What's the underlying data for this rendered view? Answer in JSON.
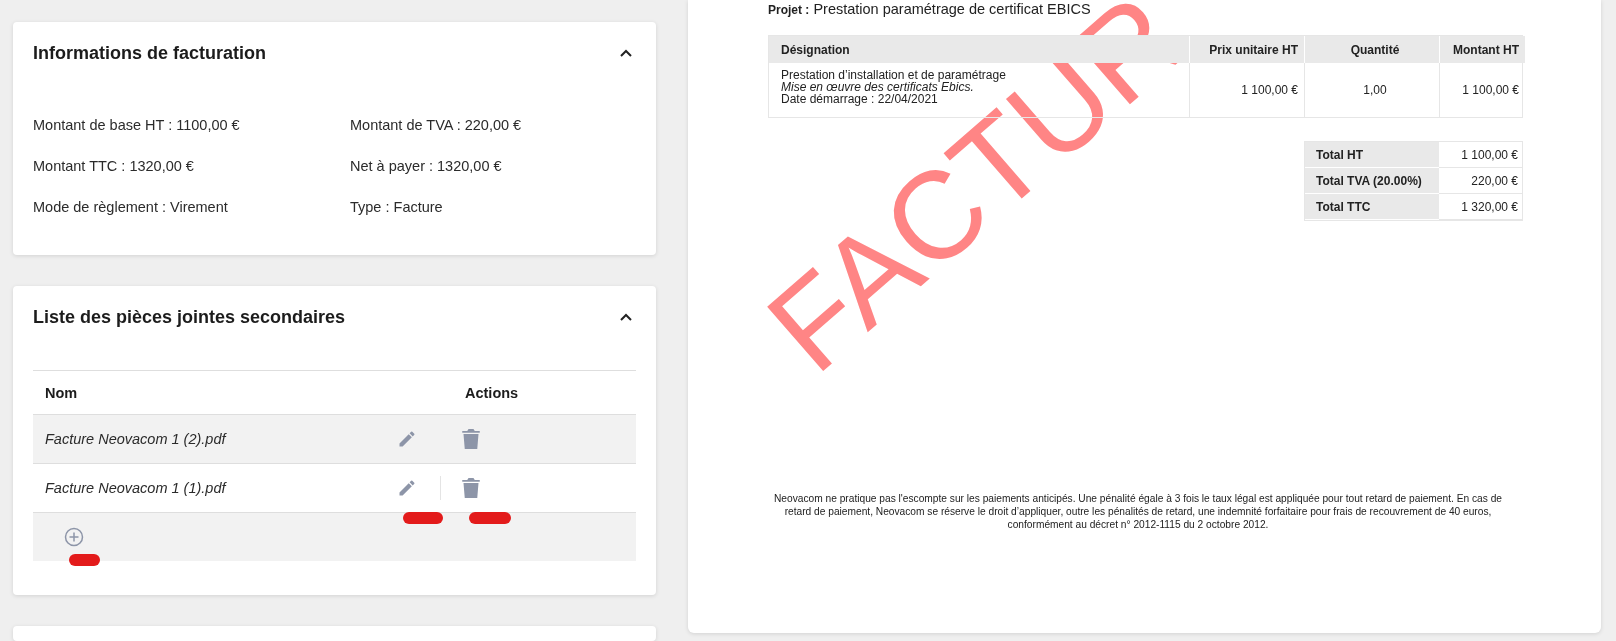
{
  "billing_card": {
    "title": "Informations de facturation",
    "expanded": true,
    "fields": [
      {
        "text": "Montant de base HT : 1100,00 €"
      },
      {
        "text": "Montant de TVA : 220,00 €"
      },
      {
        "text": "Montant TTC : 1320,00 €"
      },
      {
        "text": "Net à payer : 1320,00 €"
      },
      {
        "text": "Mode de règlement : Virement"
      },
      {
        "text": "Type : Facture"
      }
    ]
  },
  "attachments_card": {
    "title": "Liste des pièces jointes secondaires",
    "expanded": true,
    "columns": [
      "Nom",
      "Actions"
    ],
    "rows": [
      {
        "name": "Facture Neovacom 1 (2).pdf"
      },
      {
        "name": "Facture Neovacom 1 (1).pdf"
      }
    ]
  },
  "invoice": {
    "project_label": "Projet :",
    "project": "Prestation paramétrage de certificat EBICS",
    "watermark": "FACTUR",
    "columns": [
      "Désignation",
      "Prix unitaire HT",
      "Quantité",
      "Montant HT"
    ],
    "rows": [
      {
        "designation": "Prestation d’installation et de paramétrage",
        "description": "Mise en œuvre des certificats Ebics.",
        "start_date": "Date démarrage : 22/04/2021",
        "unit_price": "1 100,00 €",
        "quantity": "1,00",
        "amount": "1 100,00 €"
      }
    ],
    "totals": [
      {
        "label": "Total HT",
        "value": "1 100,00 €"
      },
      {
        "label": "Total TVA (20.00%)",
        "value": "220,00 €"
      },
      {
        "label": "Total TTC",
        "value": "1 320,00 €"
      }
    ],
    "footer": "Neovacom ne pratique pas l'escompte sur les paiements anticipés. Une pénalité égale à 3 fois le taux légal est appliquée pour tout retard de paiement. En cas de retard de paiement, Neovacom se réserve le droit d’appliquer, outre les pénalités de retard, une indemnité forfaitaire pour frais de recouvrement de 40 euros, conformément au décret n° 2012-1115 du 2 octobre 2012."
  }
}
